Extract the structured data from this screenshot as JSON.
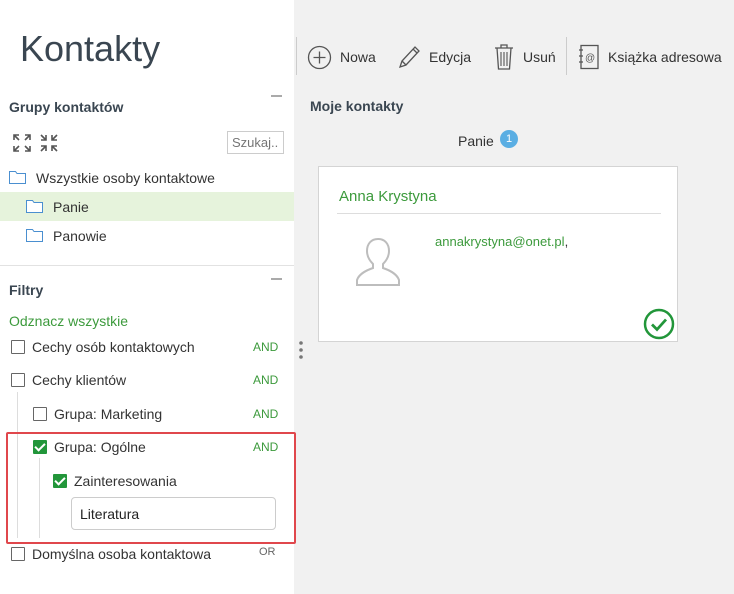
{
  "app": {
    "title": "Kontakty"
  },
  "left": {
    "groups_title": "Grupy kontaktów",
    "search_placeholder": "Szukaj...",
    "tree": [
      {
        "label": "Wszystkie osoby kontaktowe",
        "level": 0,
        "selected": false
      },
      {
        "label": "Panie",
        "level": 1,
        "selected": true
      },
      {
        "label": "Panowie",
        "level": 1,
        "selected": false
      }
    ],
    "filters_title": "Filtry",
    "select_all": "Odznacz wszystkie",
    "filters": [
      {
        "label": "Cechy osób kontaktowych",
        "checked": false,
        "op": "AND"
      },
      {
        "label": "Cechy klientów",
        "checked": false,
        "op": "AND"
      },
      {
        "label": "Grupa: Marketing",
        "checked": false,
        "op": "AND"
      },
      {
        "label": "Grupa: Ogólne",
        "checked": true,
        "op": "AND"
      },
      {
        "label": "Zainteresowania",
        "checked": true,
        "op": ""
      },
      {
        "label": "Domyślna osoba kontaktowa",
        "checked": false,
        "op": "OR"
      }
    ],
    "filter_input_value": "Literatura"
  },
  "toolbar": {
    "new_label": "Nowa",
    "edit_label": "Edycja",
    "delete_label": "Usuń",
    "address_book_label": "Książka adresowa"
  },
  "main": {
    "title": "Moje kontakty",
    "group_label": "Panie",
    "group_count": "1",
    "contact": {
      "name": "Anna Krystyna",
      "email": "annakrystyna@onet.pl",
      "email_suffix": ","
    }
  },
  "colors": {
    "accent_green": "#3c9a3c",
    "checkbox_green": "#22963a",
    "badge_blue": "#5aaee3",
    "highlight_red": "#e0474c",
    "selected_bg": "#e6f3dc"
  }
}
